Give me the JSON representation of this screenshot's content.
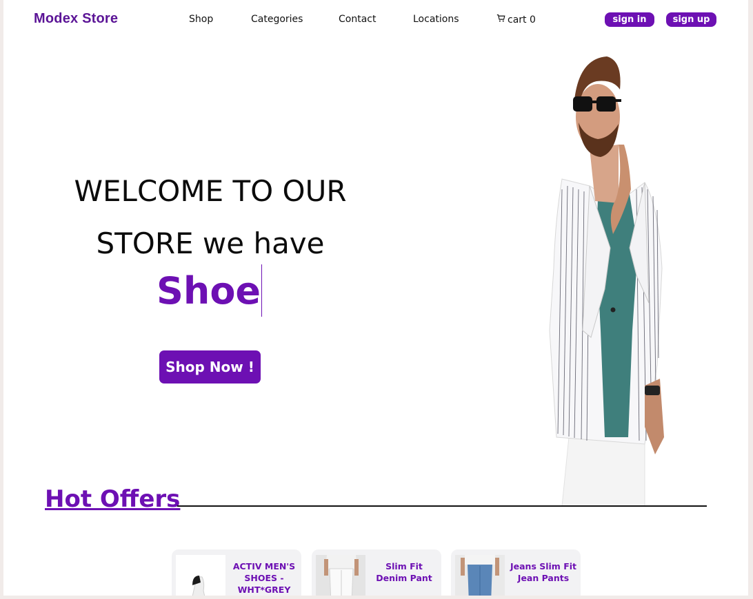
{
  "header": {
    "brand": "Modex Store",
    "nav": [
      "Shop",
      "Categories",
      "Contact",
      "Locations"
    ],
    "cart_label": "cart 0",
    "sign_in": "sign in",
    "sign_up": "sign up"
  },
  "hero": {
    "title_line1": "WELCOME TO OUR",
    "title_line2": "STORE we have",
    "typed_text": "Shoe",
    "cta": "Shop Now !"
  },
  "offers": {
    "heading": "Hot Offers",
    "products": [
      {
        "title": "ACTIV MEN'S SHOES - WHT*GREY"
      },
      {
        "title": "Slim Fit Denim Pant"
      },
      {
        "title": "Jeans Slim Fit Jean Pants"
      }
    ]
  },
  "colors": {
    "accent": "#6d10b3",
    "brand": "#5b1496"
  }
}
